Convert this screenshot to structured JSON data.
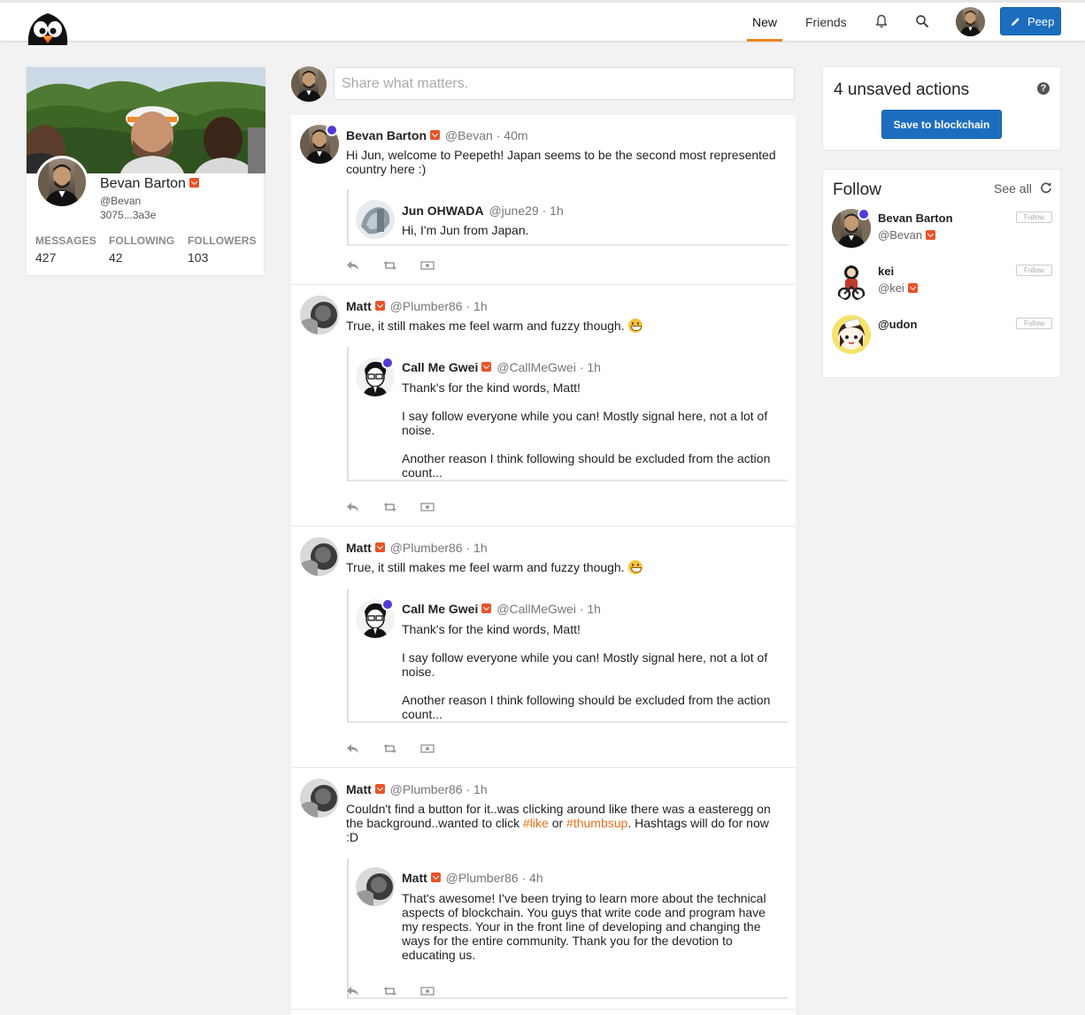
{
  "nav": {
    "tabs": [
      {
        "label": "New",
        "active": true
      },
      {
        "label": "Friends",
        "active": false
      }
    ],
    "bell_icon": "bell-icon",
    "search_icon": "search-icon",
    "peep_label": "Peep",
    "peep_icon": "pencil-icon",
    "accent_color": "#f0821e",
    "button_color": "#1d6dbf"
  },
  "profile": {
    "name": "Bevan Barton",
    "handle": "@Bevan",
    "address": "3075...3a3e",
    "stats": [
      {
        "label": "MESSAGES",
        "value": "427"
      },
      {
        "label": "FOLLOWING",
        "value": "42"
      },
      {
        "label": "FOLLOWERS",
        "value": "103"
      }
    ]
  },
  "compose": {
    "placeholder": "Share what matters."
  },
  "feed": [
    {
      "name": "Bevan Barton",
      "handle": "@Bevan",
      "time": "· 40m",
      "text": [
        "Hi Jun, welcome to Peepeth! Japan seems to be the second most represented country here :)"
      ],
      "quote": {
        "name": "Jun OHWADA",
        "handle": "@june29",
        "time": "· 1h",
        "text": [
          "Hi, I'm Jun from Japan."
        ]
      }
    },
    {
      "name": "Matt",
      "handle": "@Plumber86",
      "time": "· 1h",
      "text": [
        "True, it still makes me feel warm and fuzzy though."
      ],
      "quote": {
        "name": "Call Me Gwei",
        "handle": "@CallMeGwei",
        "time": "· 1h",
        "text": [
          "Thank's for the kind words, Matt!",
          "I say follow everyone while you can! Mostly signal here, not a lot of noise.",
          "Another reason I think following should be excluded from the action count..."
        ]
      }
    },
    {
      "name": "Matt",
      "handle": "@Plumber86",
      "time": "· 1h",
      "text": [
        "True, it still makes me feel warm and fuzzy though."
      ],
      "quote": {
        "name": "Call Me Gwei",
        "handle": "@CallMeGwei",
        "time": "· 1h",
        "text": [
          "Thank's for the kind words, Matt!",
          "I say follow everyone while you can! Mostly signal here, not a lot of noise.",
          "Another reason I think following should be excluded from the action count..."
        ]
      }
    },
    {
      "name": "Matt",
      "handle": "@Plumber86",
      "time": "· 1h",
      "text_before": "Couldn't find a button for it..was clicking around like there was a easteregg on the background..wanted to click ",
      "tag1": "#like",
      "text_mid": " or ",
      "tag2": "#thumbsup",
      "text_after": ". Hashtags will do for now :D",
      "quote": {
        "name": "Matt",
        "handle": "@Plumber86",
        "time": "· 4h",
        "text": [
          "That's awesome! I've been trying to learn more about the technical aspects of blockchain. You guys that write code and program have my respects.  Your in the front line of developing and changing the ways for the entire community.  Thank you for the devotion to educating us."
        ]
      }
    }
  ],
  "action_icons": [
    "reply-icon",
    "repeep-icon",
    "tip-icon"
  ],
  "unsaved": {
    "title": "4 unsaved actions",
    "save_label": "Save to blockchain",
    "help_icon": "question-circle-icon"
  },
  "follow": {
    "title": "Follow",
    "see_all": "See all",
    "refresh_icon": "refresh-icon",
    "users": [
      {
        "name": "Bevan Barton",
        "handle": "@Bevan",
        "button": "Follow"
      },
      {
        "name": "kei",
        "handle": "@kei",
        "button": "Follow"
      },
      {
        "name": "@udon",
        "handle": "",
        "button": "Follow"
      }
    ]
  }
}
